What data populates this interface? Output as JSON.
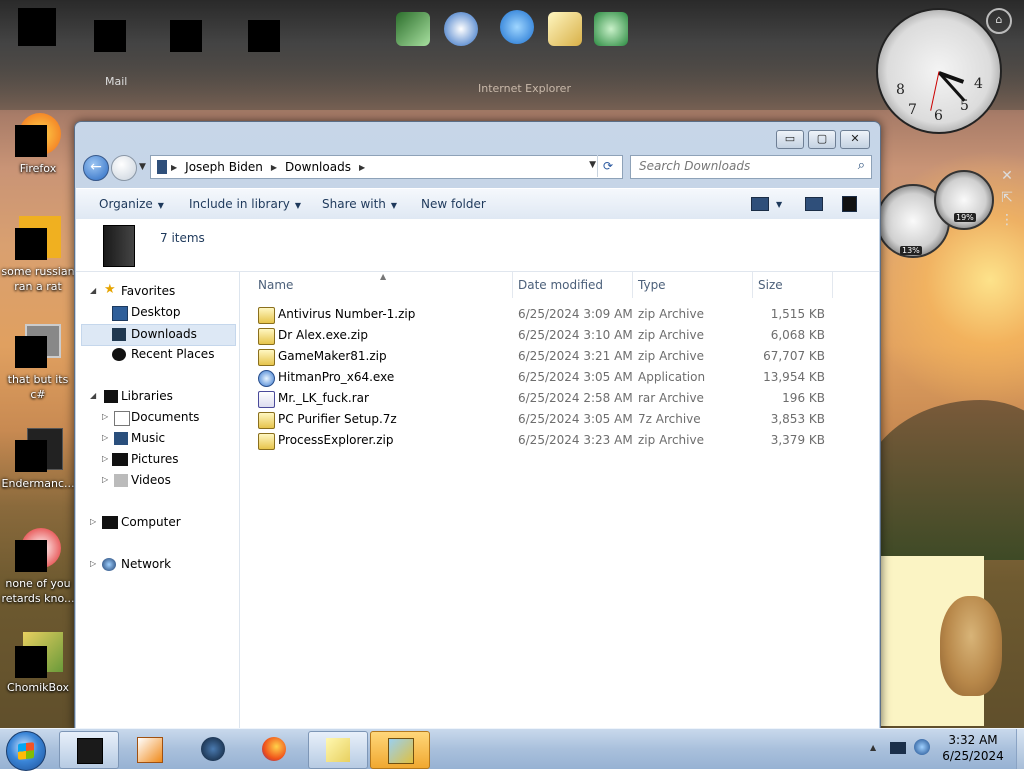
{
  "desktop": {
    "top_dock_labels": [
      "Mail",
      "Internet Explorer"
    ],
    "icons": [
      {
        "label": "Firefox"
      },
      {
        "label": "some russian ran a rat"
      },
      {
        "label": "that but its c#"
      },
      {
        "label": "Endermanc..."
      },
      {
        "label": "none of you retards kno..."
      },
      {
        "label": "ChomikBox"
      }
    ],
    "clock_numbers": [
      "8",
      "7",
      "6",
      "5",
      "4"
    ],
    "gauges": {
      "left_pct": "13%",
      "right_pct": "19%"
    }
  },
  "window": {
    "buttons": {
      "minimize": "▭",
      "maximize": "▢",
      "close": "✕"
    },
    "address": {
      "crumbs": [
        "Joseph Biden",
        "Downloads"
      ]
    },
    "search": {
      "placeholder": "Search Downloads"
    },
    "commands": {
      "organize": "Organize",
      "include_in_library": "Include in library",
      "share_with": "Share with",
      "new_folder": "New folder"
    },
    "details": {
      "item_count": "7 items"
    },
    "nav": {
      "favorites": "Favorites",
      "desktop": "Desktop",
      "downloads": "Downloads",
      "recent_places": "Recent Places",
      "libraries": "Libraries",
      "documents": "Documents",
      "music": "Music",
      "pictures": "Pictures",
      "videos": "Videos",
      "computer": "Computer",
      "network": "Network"
    },
    "columns": {
      "name": "Name",
      "date_modified": "Date modified",
      "type": "Type",
      "size": "Size"
    },
    "files": [
      {
        "name": "Antivirus Number-1.zip",
        "date": "6/25/2024 3:09 AM",
        "type": "zip Archive",
        "size": "1,515 KB",
        "icon": "zip-icon"
      },
      {
        "name": "Dr Alex.exe.zip",
        "date": "6/25/2024 3:10 AM",
        "type": "zip Archive",
        "size": "6,068 KB",
        "icon": "zip-icon"
      },
      {
        "name": "GameMaker81.zip",
        "date": "6/25/2024 3:21 AM",
        "type": "zip Archive",
        "size": "67,707 KB",
        "icon": "zip-icon"
      },
      {
        "name": "HitmanPro_x64.exe",
        "date": "6/25/2024 3:05 AM",
        "type": "Application",
        "size": "13,954 KB",
        "icon": "app-icon"
      },
      {
        "name": "Mr._LK_fuck.rar",
        "date": "6/25/2024 2:58 AM",
        "type": "rar Archive",
        "size": "196 KB",
        "icon": "rar-icon"
      },
      {
        "name": "PC Purifier Setup.7z",
        "date": "6/25/2024 3:05 AM",
        "type": "7z Archive",
        "size": "3,853 KB",
        "icon": "zip-icon"
      },
      {
        "name": "ProcessExplorer.zip",
        "date": "6/25/2024 3:23 AM",
        "type": "zip Archive",
        "size": "3,379 KB",
        "icon": "zip-icon"
      }
    ]
  },
  "taskbar": {
    "time": "3:32 AM",
    "date": "6/25/2024"
  }
}
